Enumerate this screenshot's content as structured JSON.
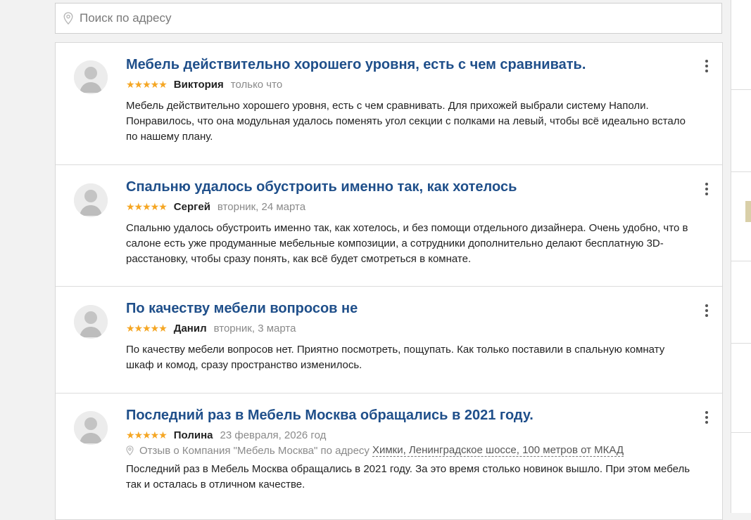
{
  "search": {
    "placeholder": "Поиск по адресу",
    "icon": "location-pin-icon"
  },
  "reviews": [
    {
      "title": "Мебель действительно хорошего уровня, есть с чем сравнивать.",
      "stars": "★★★★★",
      "rating": 5,
      "author": "Виктория",
      "time": "только что",
      "text": "Мебель действительно хорошего уровня, есть с чем сравнивать. Для прихожей выбрали систему Наполи. Понравилось, что она модульная удалось поменять угол секции с полками на левый, чтобы всё идеально встало по нашему плану."
    },
    {
      "title": "Спальню удалось обустроить именно так, как хотелось",
      "stars": "★★★★★",
      "rating": 5,
      "author": "Сергей",
      "time": "вторник, 24 марта",
      "text": "Спальню удалось обустроить именно так, как хотелось, и без помощи отдельного дизайнера. Очень удобно, что в салоне есть уже продуманные мебельные композиции, а сотрудники дополнительно делают бесплатную 3D-расстановку, чтобы сразу понять, как всё будет смотреться в комнате."
    },
    {
      "title": "По качеству мебели вопросов не",
      "stars": "★★★★★",
      "rating": 5,
      "author": "Данил",
      "time": "вторник, 3 марта",
      "text": "По качеству мебели вопросов нет. Приятно посмотреть, пощупать. Как только поставили в спальную комнату шкаф и комод, сразу пространство изменилось."
    },
    {
      "title": "Последний раз в Мебель Москва обращались в 2021 году.",
      "stars": "★★★★★",
      "rating": 5,
      "author": "Полина",
      "time": "23 февраля, 2026 год",
      "address_prefix": "Отзыв о Компания \"Мебель Москва\" по адресу",
      "address_link": "Химки, Ленинградское шоссе, 100 метров от МКАД",
      "text": "Последний раз в Мебель Москва обращались в 2021 году. За это время столько новинок вышло. При этом мебель так и осталась в отличном качестве."
    }
  ],
  "colors": {
    "title": "#1f4f8a",
    "star": "#f5a623",
    "muted": "#8a8a8a"
  }
}
